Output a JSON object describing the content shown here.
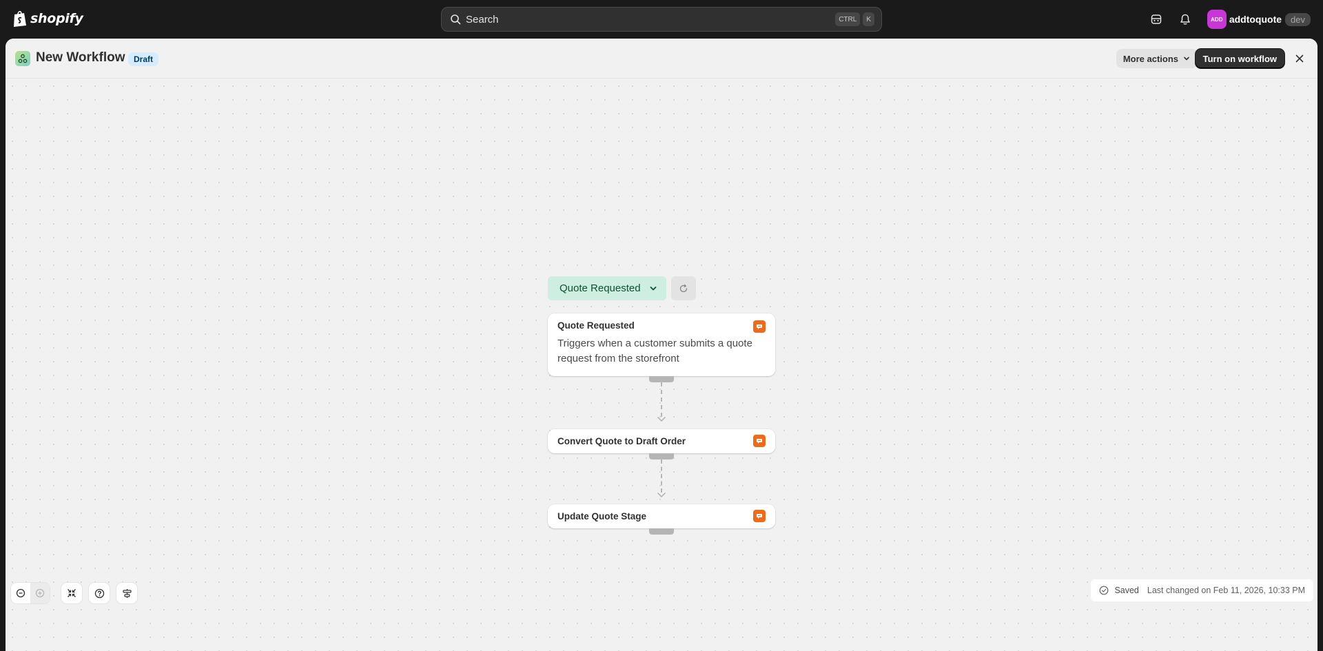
{
  "topbar": {
    "logo_text": "shopify",
    "search_placeholder": "Search",
    "shortcut_keys": [
      "CTRL",
      "K"
    ],
    "icons": [
      "shopify-bag-icon",
      "search-icon",
      "sidekick-icon",
      "bell-icon"
    ],
    "avatar_initials": "ADD",
    "avatar_color": "#c837d6",
    "store_name": "addtoquote",
    "store_badge": "dev"
  },
  "header": {
    "title": "New Workflow",
    "status": "Draft",
    "more_actions_label": "More actions",
    "primary_label": "Turn on workflow"
  },
  "flow": {
    "trigger_selector_label": "Quote Requested",
    "nodes": [
      {
        "title": "Quote Requested",
        "description": "Triggers when a customer submits a quote request from the storefront"
      },
      {
        "title": "Convert Quote to Draft Order"
      },
      {
        "title": "Update Quote Stage"
      }
    ],
    "app_badge_color": "#f16a1a",
    "trigger_color": "#cdeee0"
  },
  "footer": {
    "status_label": "Saved",
    "last_changed": "Last changed on Feb 11, 2026, 10:33 PM"
  }
}
